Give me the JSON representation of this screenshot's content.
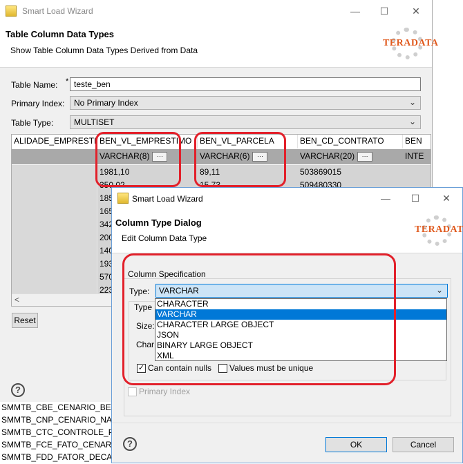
{
  "main_window": {
    "title": "Smart Load Wizard",
    "header_title": "Table Column Data Types",
    "header_subtitle": "Show Table Column Data Types Derived from Data",
    "logo": "TERADATA",
    "minimize_glyph": "—",
    "maximize_glyph": "☐",
    "close_glyph": "✕",
    "table_name_label": "Table Name:",
    "table_name_value": "teste_ben",
    "required_marker": "*",
    "primary_index_label": "Primary Index:",
    "primary_index_value": "No Primary Index",
    "table_type_label": "Table Type:",
    "table_type_value": "MULTISET",
    "combo_arrow": "⌄",
    "grid": {
      "columns": [
        "ALIDADE_EMPRESTIMO",
        "BEN_VL_EMPRESTIMO",
        "BEN_VL_PARCELA",
        "BEN_CD_CONTRATO",
        "BEN"
      ],
      "types": [
        "",
        "VARCHAR(8)",
        "VARCHAR(6)",
        "VARCHAR(20)",
        "INTE"
      ],
      "dots_label": "···",
      "rows": [
        [
          "",
          "1981,10",
          "89,11",
          "503869015",
          ""
        ],
        [
          "",
          "350,02",
          "15,73",
          "509480330",
          ""
        ],
        [
          "",
          "185",
          "",
          "",
          ""
        ],
        [
          "",
          "165",
          "",
          "",
          ""
        ],
        [
          "",
          "342",
          "",
          "",
          ""
        ],
        [
          "",
          "200",
          "",
          "",
          ""
        ],
        [
          "",
          "140",
          "",
          "",
          ""
        ],
        [
          "",
          "193",
          "",
          "",
          ""
        ],
        [
          "",
          "570",
          "",
          "",
          ""
        ],
        [
          "",
          "223",
          "",
          "",
          ""
        ]
      ],
      "scroll_left": "<"
    },
    "reset_label": "Reset",
    "help_glyph": "?"
  },
  "background_list": [
    "SMMTB_CNP_CENARIO_NAO_",
    "SMMTB_CTC_CONTROLE_PRO",
    "SMMTB_FCE_FATO_CENARIO",
    "SMMTB_FDD_FATOR_DECAIME"
  ],
  "dialog": {
    "title": "Smart Load Wizard",
    "header_title": "Column Type Dialog",
    "header_subtitle": "Edit Column Data Type",
    "logo": "TERADATA",
    "group_label": "Column Specification",
    "type_label": "Type:",
    "type_value": "VARCHAR",
    "type_options": [
      "CHARACTER",
      "VARCHAR",
      "CHARACTER LARGE OBJECT",
      "JSON",
      "BINARY LARGE OBJECT",
      "XML"
    ],
    "selected_option": "VARCHAR",
    "partial_type_label": "Type",
    "partial_size_label": "Size:",
    "partial_char_label": "Char",
    "can_contain_nulls_label": "Can contain nulls",
    "can_contain_nulls_checked": true,
    "values_unique_label": "Values must be unique",
    "values_unique_checked": false,
    "primary_index_label": "Primary Index",
    "check_glyph": "✓",
    "ok_label": "OK",
    "cancel_label": "Cancel",
    "help_glyph": "?"
  },
  "colors": {
    "highlight_box": "#e2202a",
    "selection": "#0078d7",
    "logo": "#e05a1e"
  }
}
